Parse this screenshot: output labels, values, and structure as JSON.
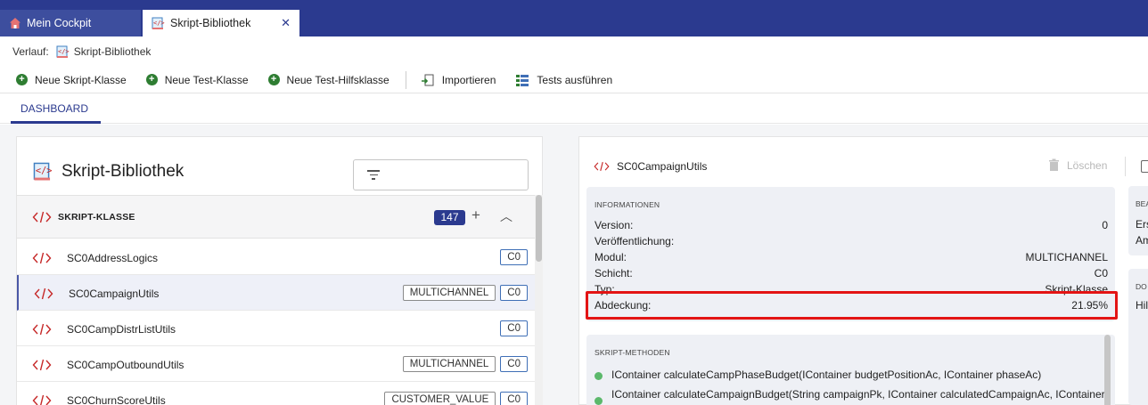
{
  "tabs": [
    {
      "label": "Mein Cockpit",
      "icon": "home-icon",
      "active": false
    },
    {
      "label": "Skript-Bibliothek",
      "icon": "script-library-icon",
      "active": true,
      "close": "✕"
    }
  ],
  "breadcrumb": {
    "prefix": "Verlauf:",
    "item": "Skript-Bibliothek"
  },
  "toolbar": {
    "new_script_class": "Neue Skript-Klasse",
    "new_test_class": "Neue Test-Klasse",
    "new_test_helper": "Neue Test-Hilfsklasse",
    "import": "Importieren",
    "run_tests": "Tests ausführen"
  },
  "subtabs": {
    "dashboard": "DASHBOARD"
  },
  "library": {
    "title": "Skript-Bibliothek",
    "filter_placeholder": "",
    "group": {
      "label": "SKRIPT-KLASSE",
      "count": "147"
    },
    "rows": [
      {
        "name": "SC0AddressLogics",
        "tags": [
          "C0"
        ],
        "selected": false
      },
      {
        "name": "SC0CampaignUtils",
        "tags": [
          "MULTICHANNEL",
          "C0"
        ],
        "selected": true
      },
      {
        "name": "SC0CampDistrListUtils",
        "tags": [
          "C0"
        ],
        "selected": false
      },
      {
        "name": "SC0CampOutboundUtils",
        "tags": [
          "MULTICHANNEL",
          "C0"
        ],
        "selected": false
      },
      {
        "name": "SC0ChurnScoreUtils",
        "tags": [
          "CUSTOMER_VALUE",
          "C0"
        ],
        "selected": false
      }
    ]
  },
  "detail": {
    "title": "SC0CampaignUtils",
    "delete_label": "Löschen",
    "info": {
      "heading": "INFORMATIONEN",
      "rows": [
        {
          "key": "Version:",
          "value": "0"
        },
        {
          "key": "Veröffentlichung:",
          "value": ""
        },
        {
          "key": "Modul:",
          "value": "MULTICHANNEL"
        },
        {
          "key": "Schicht:",
          "value": "C0"
        },
        {
          "key": "Typ:",
          "value": "Skript-Klasse"
        },
        {
          "key": "Abdeckung:",
          "value": "21.95%"
        }
      ]
    },
    "methods": {
      "heading": "SKRIPT-METHODEN",
      "items": [
        "IContainer calculateCampPhaseBudget(IContainer budgetPositionAc, IContainer phaseAc)",
        "IContainer calculateCampaignBudget(String campaignPk, IContainer calculatedCampaignAc, IContainer"
      ]
    },
    "side1": {
      "heading": "BEA",
      "lines": [
        "Ers",
        "Am"
      ]
    },
    "side2": {
      "heading": "DO",
      "lines": [
        "Hil"
      ]
    }
  },
  "colors": {
    "brand": "#2b3a8f",
    "highlight": "#e31414",
    "method_dot": "#5bb86b"
  }
}
